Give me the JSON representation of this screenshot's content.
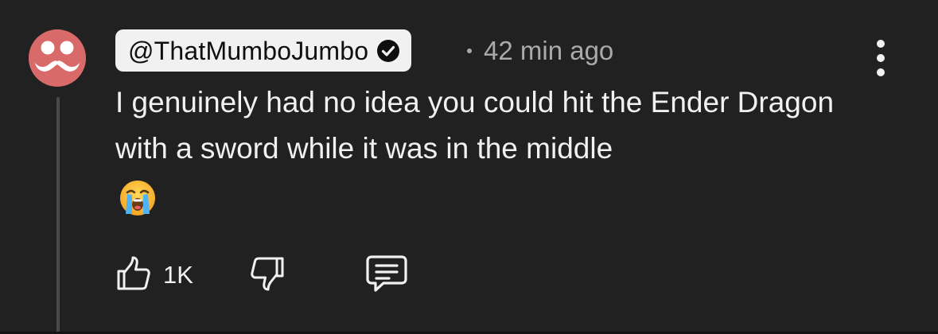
{
  "comment": {
    "author": "@ThatMumboJumbo",
    "verified": true,
    "timestamp": "42 min ago",
    "text": "I genuinely had no idea you could hit the Ender Dragon with a sword while it was in the middle",
    "emoji": "😭",
    "like_count": "1K"
  },
  "icons": {
    "avatar": "mustache-avatar-icon",
    "verified": "verified-check-icon",
    "more": "more-vertical-icon",
    "like": "thumbs-up-icon",
    "dislike": "thumbs-down-icon",
    "reply": "reply-comment-icon"
  },
  "colors": {
    "background": "#212121",
    "text": "#f1f1f1",
    "meta": "#aaaaaa",
    "avatar": "#d86a6a",
    "author_chip": "#f1f1f1"
  }
}
